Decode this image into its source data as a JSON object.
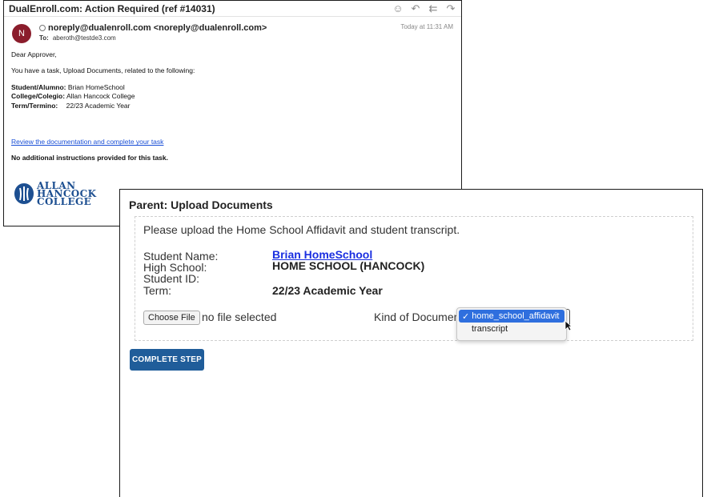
{
  "email": {
    "subject": "DualEnroll.com: Action Required (ref #14031)",
    "avatar_initial": "N",
    "from": "noreply@dualenroll.com <noreply@dualenroll.com>",
    "to_label": "To:",
    "to": "aberoth@testde3.com",
    "date": "Today at 11:31 AM",
    "greeting": "Dear Approver,",
    "task_line": "You have a task, Upload Documents, related to the following:",
    "student_label": "Student/Alumno:",
    "student_value": "Brian HomeSchool",
    "college_label": "College/Colegio:",
    "college_value": "Allan Hancock College",
    "term_label": "Term/Termino:",
    "term_value": "22/23 Academic Year",
    "link_text": "Review the documentation and complete your task",
    "no_instructions": "No additional instructions provided for this task.",
    "actions": [
      "smiley-icon",
      "reply-icon",
      "reply-all-icon",
      "forward-icon"
    ]
  },
  "logo": {
    "line1": "ALLAN",
    "line2": "HANCOCK",
    "line3": "COLLEGE",
    "brand_color": "#1d4f91"
  },
  "panel": {
    "title": "Parent: Upload Documents",
    "instruction": "Please upload the Home School Affidavit and student transcript.",
    "student_name_label": "Student Name:",
    "student_name_value": "Brian HomeSchool",
    "high_school_label": "High School:",
    "high_school_value": "HOME SCHOOL (HANCOCK)",
    "student_id_label": "Student ID:",
    "term_label": "Term:",
    "term_value": "22/23 Academic Year",
    "choose_file_label": "Choose File",
    "no_file_text": "no file selected",
    "kind_label": "Kind of Document",
    "kind_options": [
      "home_school_affidavit",
      "transcript"
    ],
    "selected_check": "✓",
    "complete_button": "COMPLETE STEP",
    "button_color": "#205d9a"
  }
}
